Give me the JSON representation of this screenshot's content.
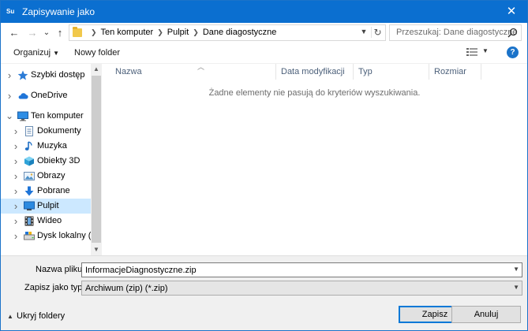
{
  "window": {
    "title": "Zapisywanie jako",
    "app_icon": "Su",
    "close_glyph": "✕"
  },
  "nav": {
    "back_glyph": "←",
    "forward_glyph": "→",
    "recent_glyph": "⌄",
    "up_glyph": "↑",
    "breadcrumbs": [
      "Ten komputer",
      "Pulpit",
      "Dane diagostyczne"
    ],
    "search_placeholder": "Przeszukaj: Dane diagostyczne"
  },
  "toolbar": {
    "organize_label": "Organizuj",
    "new_folder_label": "Nowy folder",
    "help_glyph": "?"
  },
  "sidebar": {
    "items": [
      {
        "label": "Szybki dostęp",
        "icon": "star-icon",
        "indent": 0
      },
      {
        "label": "OneDrive",
        "icon": "cloud-icon",
        "indent": 0
      },
      {
        "label": "Ten komputer",
        "icon": "computer-icon",
        "indent": 0,
        "expanded": true
      },
      {
        "label": "Dokumenty",
        "icon": "document-icon",
        "indent": 1
      },
      {
        "label": "Muzyka",
        "icon": "music-icon",
        "indent": 1
      },
      {
        "label": "Obiekty 3D",
        "icon": "cube-icon",
        "indent": 1
      },
      {
        "label": "Obrazy",
        "icon": "picture-icon",
        "indent": 1
      },
      {
        "label": "Pobrane",
        "icon": "download-icon",
        "indent": 1
      },
      {
        "label": "Pulpit",
        "icon": "desktop-icon",
        "indent": 1,
        "selected": true
      },
      {
        "label": "Wideo",
        "icon": "video-icon",
        "indent": 1
      },
      {
        "label": "Dysk lokalny (C:)",
        "icon": "drive-icon",
        "indent": 1
      }
    ]
  },
  "filelist": {
    "columns": [
      "Nazwa",
      "Data modyfikacji",
      "Typ",
      "Rozmiar"
    ],
    "empty_message": "Żadne elementy nie pasują do kryteriów wyszukiwania."
  },
  "form": {
    "filename_label": "Nazwa pliku:",
    "filename_value": "InformacjeDiagnostyczne.zip",
    "filetype_label": "Zapisz jako typ:",
    "filetype_value": "Archiwum (zip) (*.zip)",
    "hide_folders_label": "Ukryj foldery",
    "save_label": "Zapisz",
    "cancel_label": "Anuluj"
  },
  "colors": {
    "titlebar": "#0b6fd0",
    "selection": "#cce8ff",
    "accent": "#0078d7"
  }
}
